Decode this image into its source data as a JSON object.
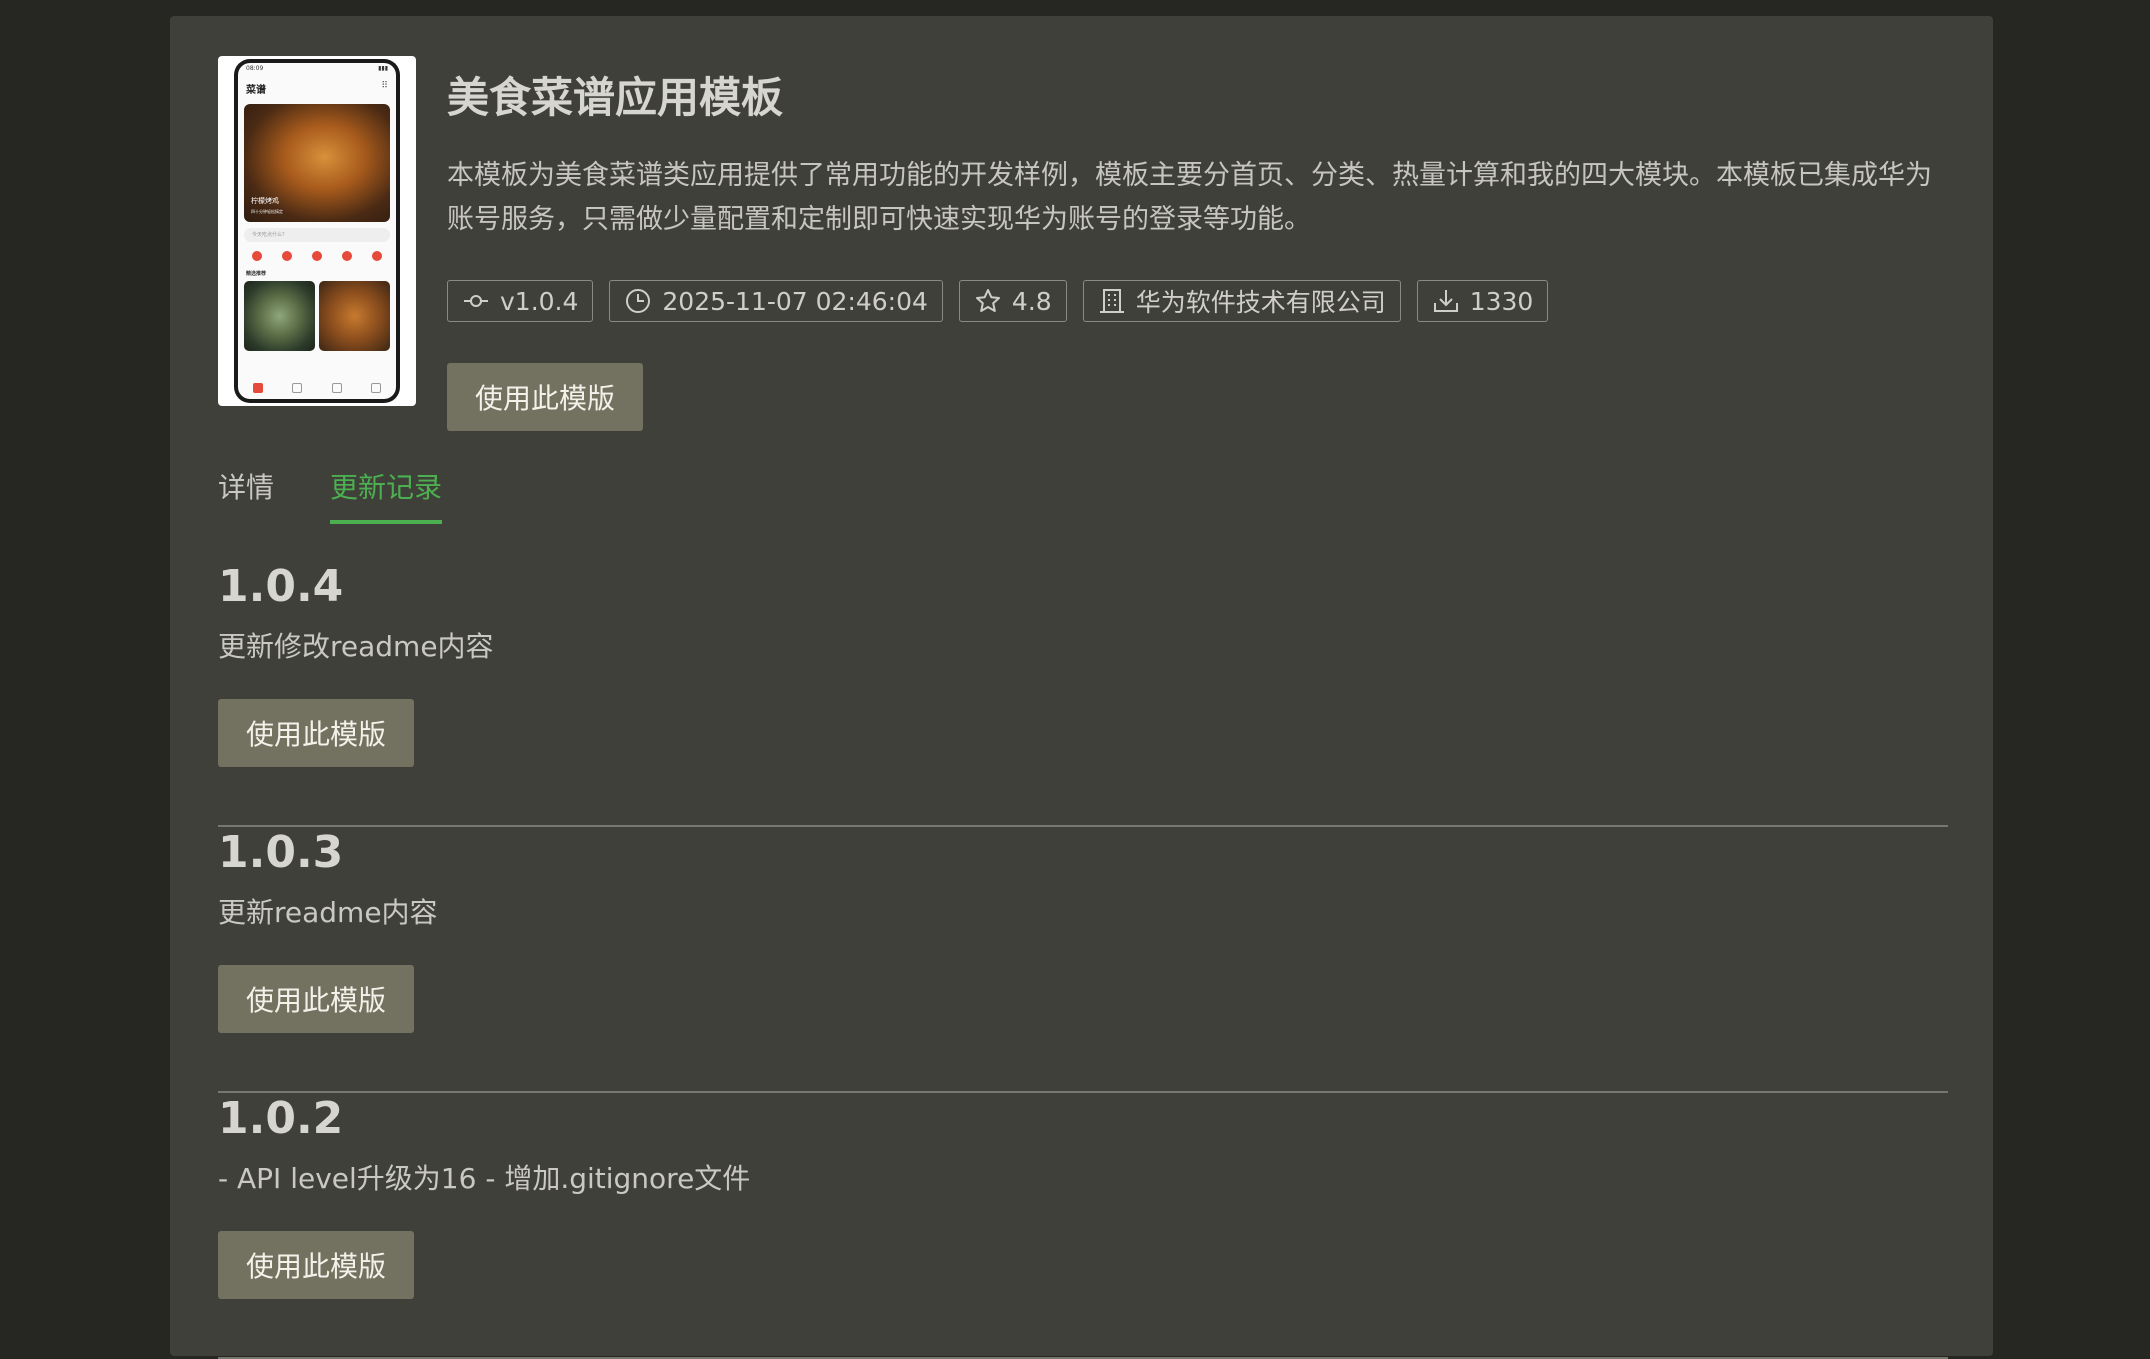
{
  "template": {
    "title": "美食菜谱应用模板",
    "description": "本模板为美食菜谱类应用提供了常用功能的开发样例，模板主要分首页、分类、热量计算和我的四大模块。本模板已集成华为账号服务，只需做少量配置和定制即可快速实现华为账号的登录等功能。",
    "version": "v1.0.4",
    "updated": "2025-11-07 02:46:04",
    "rating": "4.8",
    "publisher": "华为软件技术有限公司",
    "downloads": "1330",
    "use_label": "使用此模版"
  },
  "preview": {
    "status_time": "08:09",
    "app_title": "菜谱",
    "hero_title": "柠檬烤鸡",
    "hero_sub": "四十分钟轻松搞定",
    "search_placeholder": "今天吃点什么？",
    "section_title": "精选推荐"
  },
  "tabs": [
    {
      "label": "详情",
      "active": false
    },
    {
      "label": "更新记录",
      "active": true
    }
  ],
  "changelog": [
    {
      "version": "1.0.4",
      "note": "更新修改readme内容",
      "button": "使用此模版"
    },
    {
      "version": "1.0.3",
      "note": "更新readme内容",
      "button": "使用此模版"
    },
    {
      "version": "1.0.2",
      "note": "- API level升级为16 - 增加.gitignore文件",
      "button": "使用此模版"
    }
  ],
  "colors": {
    "accent": "#4caf50",
    "button_bg": "#737260",
    "panel_bg": "#40403a",
    "page_bg": "#262722"
  },
  "icons": [
    "version-icon",
    "clock-icon",
    "star-icon",
    "building-icon",
    "download-icon",
    "grid-icon"
  ]
}
